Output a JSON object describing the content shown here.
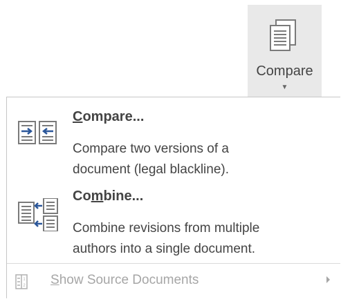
{
  "ribbon": {
    "compare_label": "Compare",
    "compare_icon": "compare-documents-icon",
    "caret_icon": "chevron-down-icon"
  },
  "menu": {
    "items": [
      {
        "title_pre": "",
        "title_accel": "C",
        "title_post": "ompare...",
        "desc_line1": "Compare two versions of a",
        "desc_line2": "document (legal blackline).",
        "icon": "compare-icon"
      },
      {
        "title_pre": "Co",
        "title_accel": "m",
        "title_post": "bine...",
        "desc_line1": "Combine revisions from multiple",
        "desc_line2": "authors into a single document.",
        "icon": "combine-icon"
      }
    ],
    "show_source": {
      "label_accel": "S",
      "label_post": "how Source Documents",
      "icon": "source-documents-icon",
      "submenu_icon": "chevron-right-icon",
      "disabled": true
    }
  },
  "colors": {
    "ribbon_bg": "#e9e9e9",
    "text": "#444444",
    "disabled_text": "#a6a6a6",
    "icon_blue": "#2b579a",
    "icon_gray": "#7a7a7a"
  }
}
